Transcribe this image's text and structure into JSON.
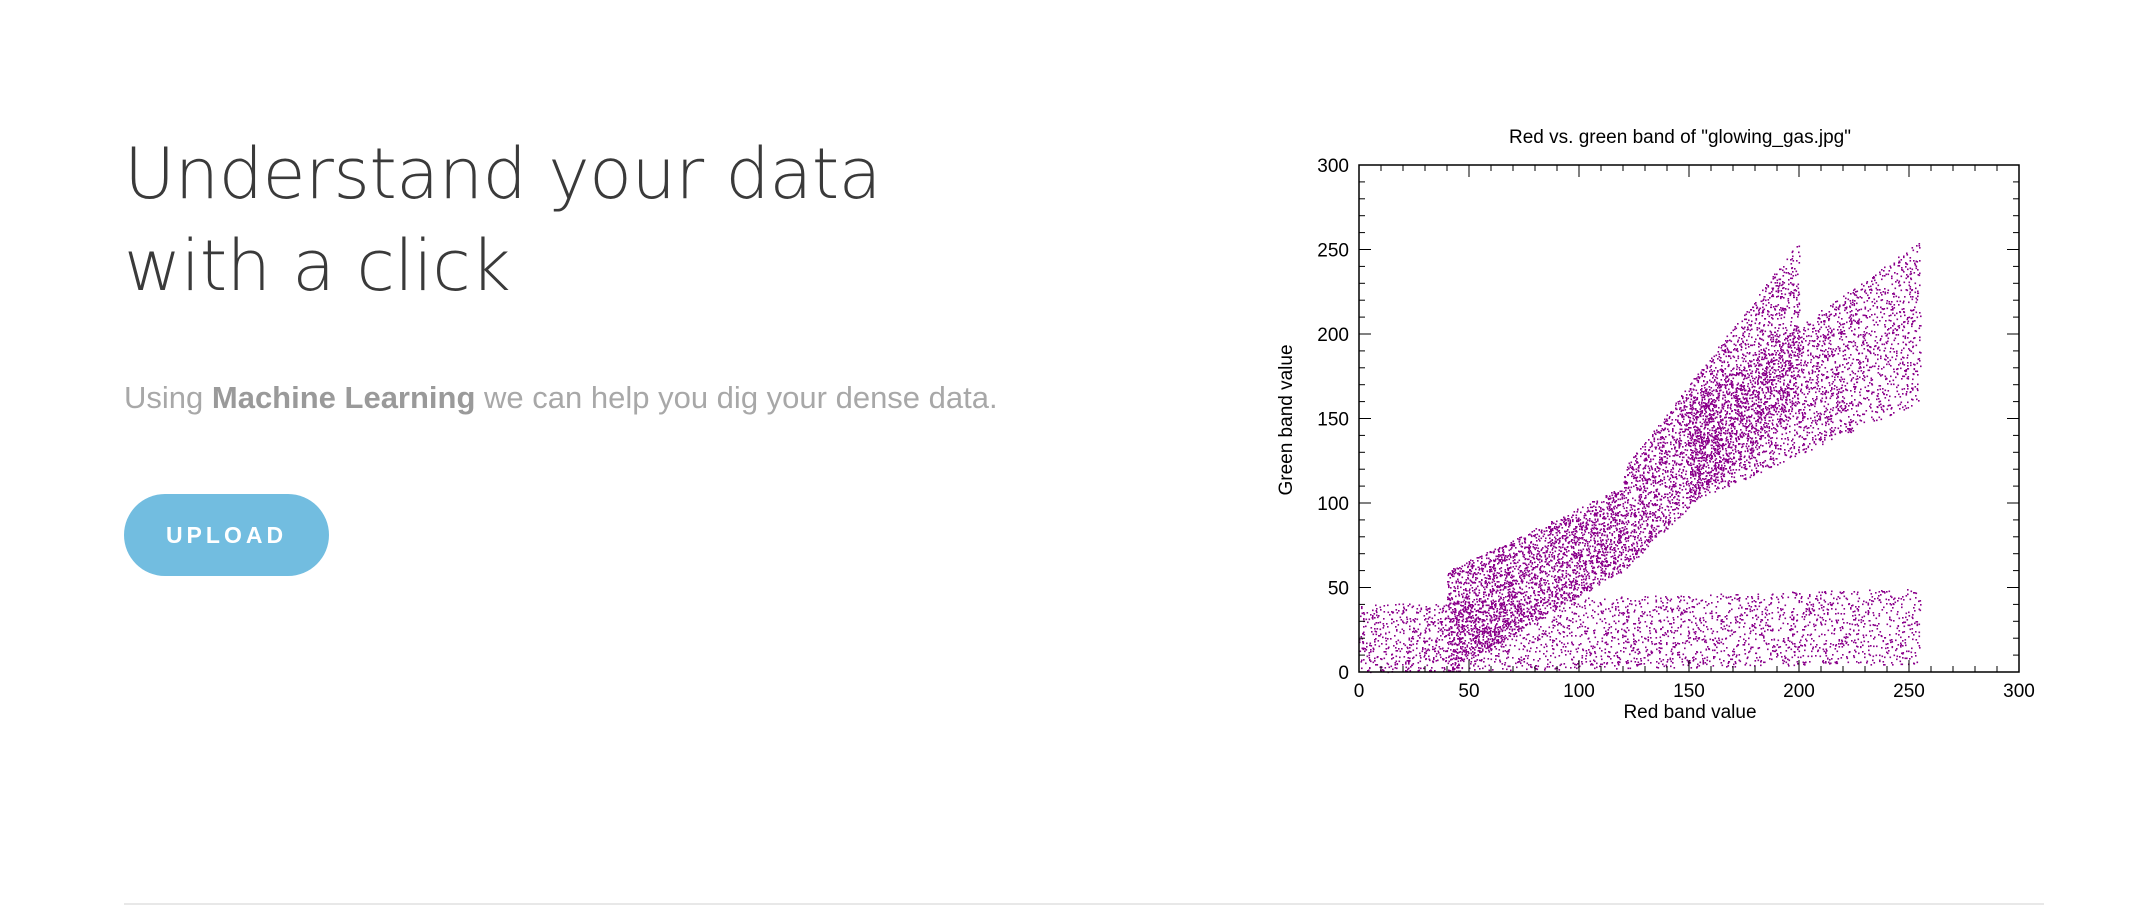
{
  "hero": {
    "title": "Understand your data with a click",
    "subtitle_prefix": "Using ",
    "subtitle_bold": "Machine Learning",
    "subtitle_suffix": " we can help you dig your dense data.",
    "upload_label": "UPLOAD"
  },
  "colors": {
    "accent": "#72bde0",
    "points": "#8b008b"
  },
  "chart_data": {
    "type": "scatter",
    "title": "Red vs. green band of \"glowing_gas.jpg\"",
    "xlabel": "Red band value",
    "ylabel": "Green band value",
    "xlim": [
      0,
      300
    ],
    "ylim": [
      0,
      300
    ],
    "xticks": [
      0,
      50,
      100,
      150,
      200,
      250,
      300
    ],
    "yticks": [
      0,
      50,
      100,
      150,
      200,
      250,
      300
    ],
    "grid": false,
    "series": [
      {
        "color": "#8b008b",
        "density_bands": [
          {
            "x": [
              0,
              255
            ],
            "y_low": [
              0,
              5
            ],
            "y_high": [
              40,
              50
            ]
          },
          {
            "x": [
              40,
              120
            ],
            "y_low": [
              0,
              60
            ],
            "y_high": [
              60,
              110
            ]
          },
          {
            "x": [
              120,
              200
            ],
            "y_low": [
              60,
              160
            ],
            "y_high": [
              120,
              255
            ]
          },
          {
            "x": [
              150,
              255
            ],
            "y_low": [
              100,
              160
            ],
            "y_high": [
              160,
              255
            ]
          }
        ],
        "x_max": 255,
        "y_max": 255
      }
    ]
  }
}
